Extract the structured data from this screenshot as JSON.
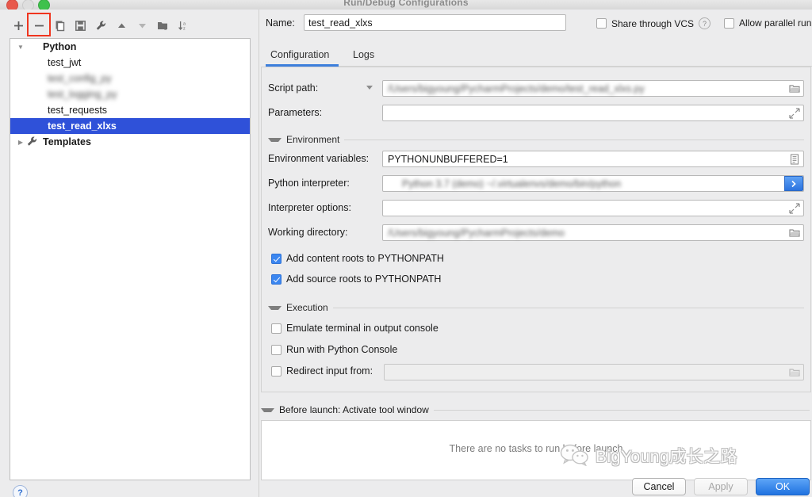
{
  "window": {
    "title": "Run/Debug Configurations",
    "traffic_lights": [
      "close-red",
      "minimize-amber-disabled",
      "zoom-green"
    ]
  },
  "toolbar": {
    "buttons": [
      {
        "name": "add-configuration-button",
        "icon": "plus-icon",
        "label": "+",
        "highlighted": false
      },
      {
        "name": "remove-configuration-button",
        "icon": "minus-icon",
        "label": "−",
        "highlighted": true
      },
      {
        "name": "copy-configuration-button",
        "icon": "copy-icon",
        "label": "",
        "highlighted": false
      },
      {
        "name": "save-configuration-button",
        "icon": "save-icon",
        "label": "",
        "highlighted": false
      },
      {
        "name": "edit-templates-button",
        "icon": "wrench-icon",
        "label": "",
        "highlighted": false
      },
      {
        "name": "move-up-button",
        "icon": "arrow-up-icon",
        "label": "",
        "highlighted": false
      },
      {
        "name": "move-down-button",
        "icon": "arrow-down-icon",
        "label": "",
        "highlighted": false
      },
      {
        "name": "new-folder-button",
        "icon": "folder-add-icon",
        "label": "",
        "highlighted": false
      },
      {
        "name": "sort-configurations-button",
        "icon": "sort-alphabetical-icon",
        "label": "",
        "highlighted": false
      }
    ]
  },
  "tree": {
    "items": [
      {
        "label": "Python",
        "icon": "python-icon",
        "level": 0,
        "expanded": true,
        "bold": true,
        "selected": false,
        "blurred": false
      },
      {
        "label": "test_jwt",
        "icon": "python-icon",
        "level": 1,
        "expanded": null,
        "bold": false,
        "selected": false,
        "blurred": false
      },
      {
        "label": "test_config_py",
        "icon": "python-icon",
        "level": 1,
        "expanded": null,
        "bold": false,
        "selected": false,
        "blurred": true
      },
      {
        "label": "test_logging_py",
        "icon": "python-icon",
        "level": 1,
        "expanded": null,
        "bold": false,
        "selected": false,
        "blurred": true
      },
      {
        "label": "test_requests",
        "icon": "python-icon",
        "level": 1,
        "expanded": null,
        "bold": false,
        "selected": false,
        "blurred": false
      },
      {
        "label": "test_read_xlxs",
        "icon": "python-icon",
        "level": 1,
        "expanded": null,
        "bold": true,
        "selected": true,
        "blurred": false
      },
      {
        "label": "Templates",
        "icon": "wrench-icon",
        "level": 0,
        "expanded": false,
        "bold": true,
        "selected": false,
        "blurred": false
      }
    ]
  },
  "help_button": {
    "label": "?"
  },
  "header": {
    "name_label": "Name:",
    "name_value": "test_read_xlxs",
    "share_vcs_label": "Share through VCS",
    "share_vcs_checked": false,
    "share_vcs_help": "?",
    "allow_parallel_label": "Allow parallel run",
    "allow_parallel_checked": false
  },
  "tabs": {
    "items": [
      {
        "label": "Configuration",
        "active": true
      },
      {
        "label": "Logs",
        "active": false
      }
    ],
    "accent_color": "#3d7fdc"
  },
  "configuration": {
    "script_path_label": "Script path:",
    "script_path_value": "/Users/bigyoung/PycharmProjects/demo/test_read_xlxs.py",
    "script_path_blurred": true,
    "parameters_label": "Parameters:",
    "parameters_value": "",
    "environment_section": "Environment",
    "env_vars_label": "Environment variables:",
    "env_vars_value": "PYTHONUNBUFFERED=1",
    "interpreter_label": "Python interpreter:",
    "interpreter_value": "Python 3.7 (demo) ~/.virtualenvs/demo/bin/python",
    "interpreter_blurred": true,
    "interpreter_options_label": "Interpreter options:",
    "interpreter_options_value": "",
    "working_dir_label": "Working directory:",
    "working_dir_value": "/Users/bigyoung/PycharmProjects/demo",
    "working_dir_blurred": true,
    "add_content_roots_label": "Add content roots to PYTHONPATH",
    "add_content_roots_checked": true,
    "add_source_roots_label": "Add source roots to PYTHONPATH",
    "add_source_roots_checked": true,
    "execution_section": "Execution",
    "emulate_terminal_label": "Emulate terminal in output console",
    "emulate_terminal_checked": false,
    "run_with_console_label": "Run with Python Console",
    "run_with_console_checked": false,
    "redirect_input_label": "Redirect input from:",
    "redirect_input_checked": false,
    "redirect_input_value": ""
  },
  "before_launch": {
    "section_label": "Before launch: Activate tool window",
    "empty_text": "There are no tasks to run before launch"
  },
  "footer": {
    "cancel_label": "Cancel",
    "apply_label": "Apply",
    "apply_disabled": true,
    "ok_label": "OK",
    "ok_color": "#2b7ae4"
  },
  "watermark": {
    "text": "BigYoung成长之路",
    "icon": "wechat-icon"
  }
}
